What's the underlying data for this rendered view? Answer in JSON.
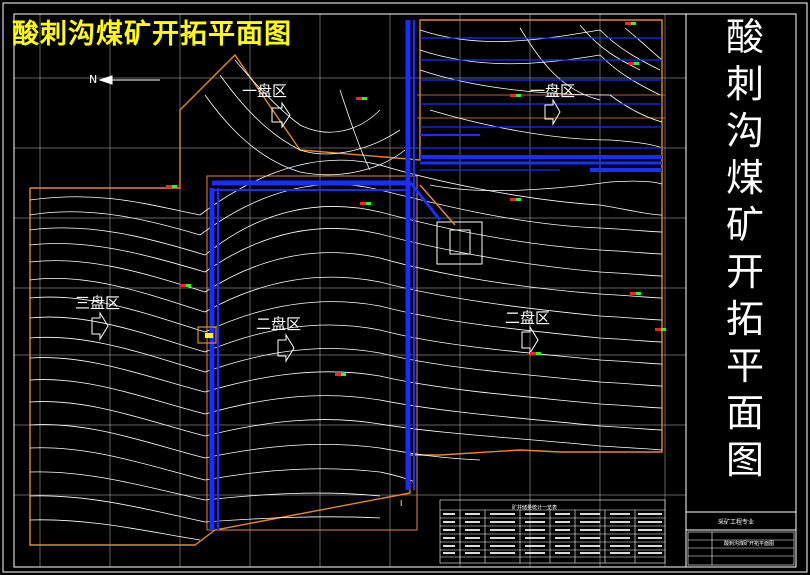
{
  "drawing": {
    "title": "酸刺沟煤矿开拓平面图",
    "side_title_chars": [
      "酸",
      "刺",
      "沟",
      "煤",
      "矿",
      "开",
      "拓",
      "平",
      "面",
      "图"
    ],
    "zones": {
      "zone_1_west": "一盘区",
      "zone_1_east": "一盘区",
      "zone_3": "三盘区",
      "zone_2_center": "二盘区",
      "zone_2_east": "二盘区"
    },
    "north_label": "N",
    "marker_i": "I",
    "title_block": {
      "school": "采矿工程专业",
      "drawing_name": "酸刺沟煤矿开拓平面图"
    },
    "table_header": "矿井储量统计一览表",
    "colors": {
      "background": "#000000",
      "title": "#ffff00",
      "contour": "#ffffff",
      "roadway": "#1a2cff",
      "boundary": "#e08a2e",
      "grid": "#ffffff"
    }
  }
}
